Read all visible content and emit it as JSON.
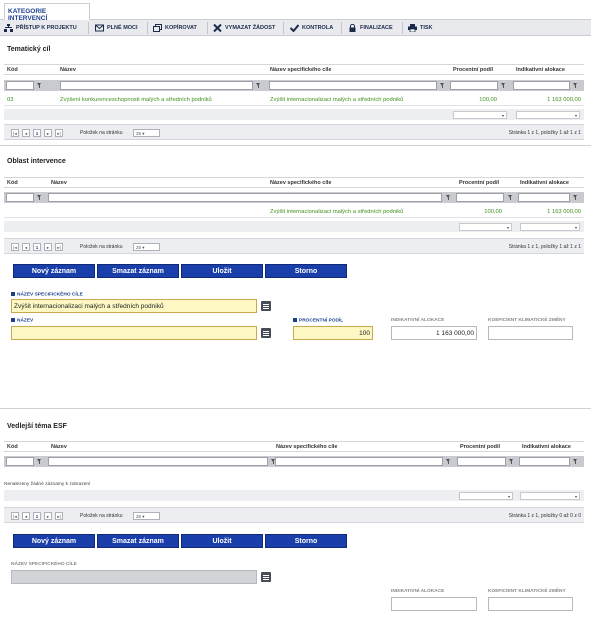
{
  "tab": {
    "label": "KATEGORIE INTERVENCÍ"
  },
  "toolbar": [
    {
      "label": "PŘÍSTUP K PROJEKTU",
      "icon": "sitemap-icon"
    },
    {
      "label": "PLNÉ MOCI",
      "icon": "envelope-icon"
    },
    {
      "label": "KOPÍROVAT",
      "icon": "copy-icon"
    },
    {
      "label": "VYMAZAT ŽÁDOST",
      "icon": "cross-icon"
    },
    {
      "label": "KONTROLA",
      "icon": "check-icon"
    },
    {
      "label": "FINALIZACE",
      "icon": "lock-icon"
    },
    {
      "label": "TISK",
      "icon": "printer-icon"
    }
  ],
  "tematicky": {
    "title": "Tematický cíl",
    "headers": [
      "Kód",
      "Název",
      "Název specifického cíle",
      "Procentní podíl",
      "Indikativní alokace"
    ],
    "rows": [
      [
        "03",
        "Zvýšení konkurenceschopnosti malých a středních podniků",
        "Zvýšit internacionalizaci malých a středních podniků",
        "100,00",
        "1 163 000,00"
      ]
    ],
    "pager": {
      "size_label": "Položek na stránku",
      "size": "25",
      "page_num": "1",
      "status": "Stránka 1 z 1, položky 1 až 1 z 1"
    }
  },
  "oblast": {
    "title": "Oblast intervence",
    "headers": [
      "Kód",
      "Název",
      "Název specifického cíle",
      "Procentní podíl",
      "Indikativní alokace"
    ],
    "rows": [
      [
        "",
        "",
        "Zvýšit internacionalizaci malých a středních podniků",
        "100,00",
        "1 163 000,00"
      ]
    ],
    "pager": {
      "size_label": "Položek na stránku",
      "size": "25",
      "page_num": "1",
      "status": "Stránka 1 z 1, položky 1 až 1 z 1"
    }
  },
  "buttons": {
    "new": "Nový záznam",
    "delete": "Smazat záznam",
    "save": "Uložit",
    "cancel": "Storno"
  },
  "form1": {
    "spec_label": "NÁZEV SPECIFICKÉHO CÍLE",
    "spec_value": "Zvýšit internacionalizaci malých a středních podniků",
    "name_label": "NÁZEV",
    "name_value": "",
    "pct_label": "PROCENTNÍ PODÍL",
    "pct_value": "100",
    "alloc_label": "INDIKATIVNÍ ALOKACE",
    "alloc_value": "1 163 000,00",
    "coef_label": "KOEFICIENT KLIMATICKÉ ZMĚNY",
    "coef_value": ""
  },
  "vedlejsi": {
    "title": "Vedlejší téma ESF",
    "headers": [
      "Kód",
      "Název",
      "Název specifického cíle",
      "Procentní podíl",
      "Indikativní alokace"
    ],
    "nodata": "Nenalezeny žádné záznamy k zobrazení",
    "pager": {
      "size_label": "Položek na stránku",
      "size": "25",
      "page_num": "1",
      "status": "Stránka 1 z 1, položky 0 až 0 z 0"
    }
  },
  "form2": {
    "spec_label": "NÁZEV SPECIFICKÉHO CÍLE",
    "spec_value": "",
    "alloc_label": "INDIKATIVNÍ ALOKACE",
    "coef_label": "KOEFICIENT KLIMATICKÉ ZMĚNY"
  },
  "colors": {
    "accent": "#1a3faa",
    "row_text": "#3e8f1c",
    "required_field": "#fdf7c3"
  }
}
